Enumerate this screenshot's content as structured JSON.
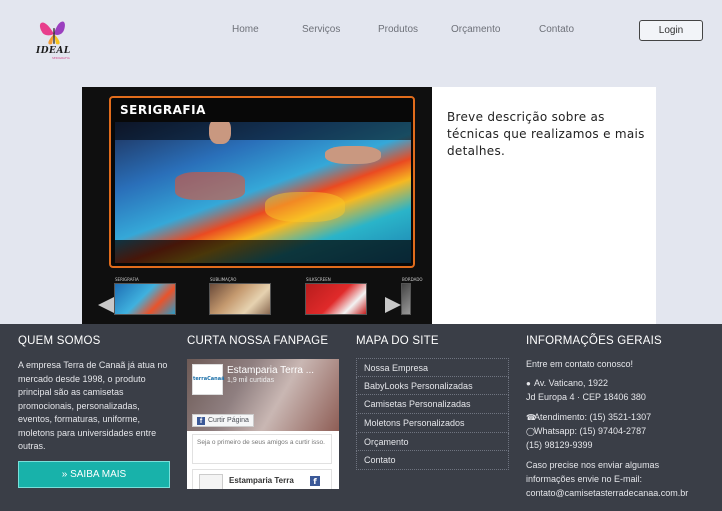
{
  "header": {
    "logo": {
      "name": "IDEAL",
      "tagline": "SERIGRAFIA"
    },
    "nav": [
      {
        "label": "Home"
      },
      {
        "label": "Serviços"
      },
      {
        "label": "Produtos"
      },
      {
        "label": "Orçamento"
      },
      {
        "label": "Contato"
      }
    ],
    "login_label": "Login"
  },
  "hero": {
    "slide_title": "SERIGRAFIA",
    "thumbnails": [
      {
        "label": "SERIGRAFIA"
      },
      {
        "label": "SUBLIMAÇÃO"
      },
      {
        "label": "SILKSCREEN"
      },
      {
        "label": "BORDADO"
      }
    ],
    "description": "Breve descrição sobre as técnicas que realizamos e mais detalhes."
  },
  "footer": {
    "about": {
      "title": "QUEM SOMOS",
      "text": "A empresa Terra de Canaã já atua no mercado desde 1998, o produto principal são as camisetas promocionais, personalizadas, eventos, formaturas, uniforme, moletons para universidades entre outras.",
      "button_label": "» SAIBA MAIS"
    },
    "fanpage": {
      "title": "CURTA NOSSA FANPAGE",
      "page_name": "Estamparia Terra ...",
      "likes": "1,9 mil curtidas",
      "like_button": "Curtir Página",
      "note": "Seja o primeiro de seus amigos a curtir isso.",
      "post_name": "Estamparia Terra",
      "avatar_text": "terraCanaã"
    },
    "sitemap": {
      "title": "MAPA DO SITE",
      "items": [
        {
          "label": "Nossa Empresa"
        },
        {
          "label": "BabyLooks Personalizadas"
        },
        {
          "label": "Camisetas Personalizadas"
        },
        {
          "label": "Moletons Personalizados"
        },
        {
          "label": "Orçamento"
        },
        {
          "label": "Contato"
        }
      ]
    },
    "info": {
      "title": "INFORMAÇÕES GERAIS",
      "intro": "Entre em contato conosco!",
      "address1": "Av. Vaticano, 1922",
      "address2": "Jd Europa 4 · CEP 18406 380",
      "phone": "Atendimento: (15) 3521-1307",
      "whatsapp": "Whatsapp: (15) 97404-2787",
      "mobile": "(15) 98129-9399",
      "email_note_1": "Caso precise nos enviar algumas",
      "email_note_2": "informações envie no E-mail:",
      "email": "contato@camisetasterradecanaa.com.br"
    }
  },
  "colors": {
    "page_bg": "#e3e6ef",
    "footer_bg": "#3a3e47",
    "accent_teal": "#18b2aa",
    "frame_orange": "#e16c1c"
  }
}
